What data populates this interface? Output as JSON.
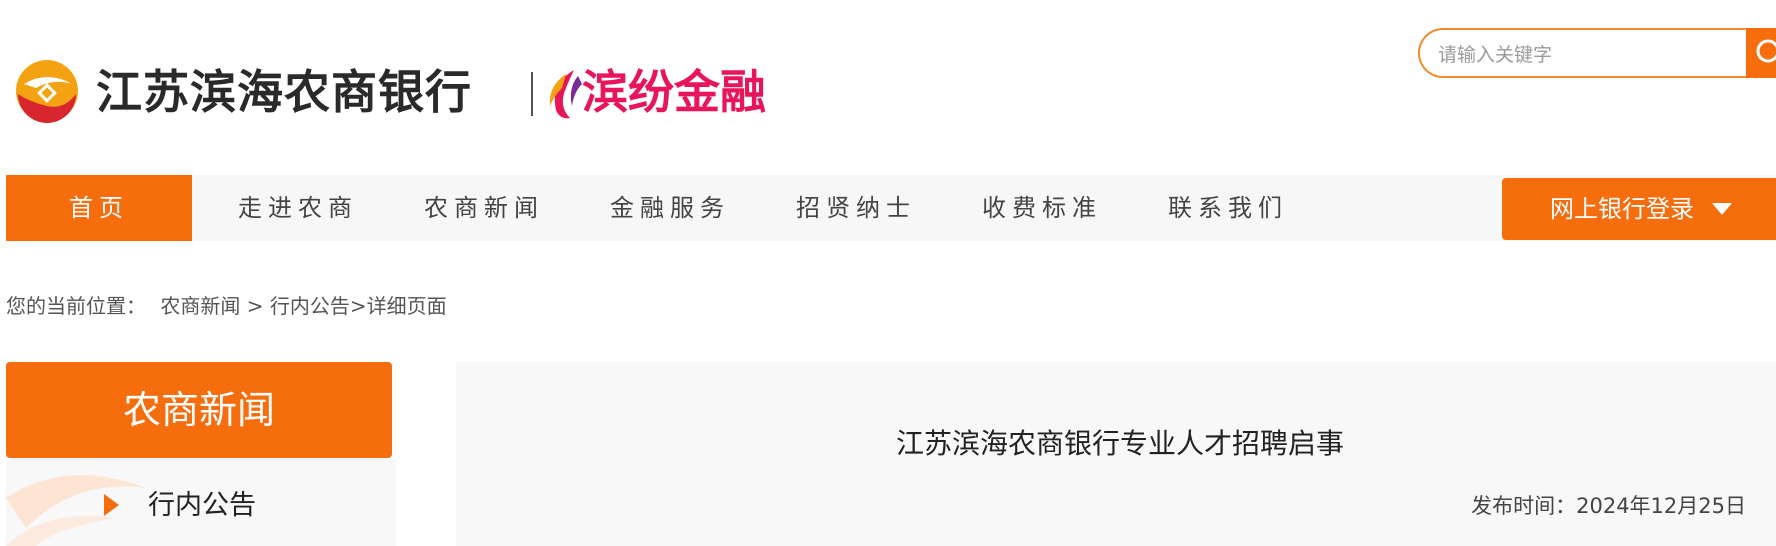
{
  "logo": {
    "bank_name": "江苏滨海农商银行",
    "slogan": "滨纷金融"
  },
  "search": {
    "placeholder": "请输入关键字"
  },
  "nav": {
    "items": [
      "首页",
      "走进农商",
      "农商新闻",
      "金融服务",
      "招贤纳士",
      "收费标准",
      "联系我们"
    ],
    "active_index": 0,
    "login_label": "网上银行登录"
  },
  "breadcrumb": {
    "label": "您的当前位置：",
    "path": "农商新闻 > 行内公告>详细页面"
  },
  "sidebar": {
    "title": "农商新闻",
    "items": [
      "行内公告"
    ]
  },
  "article": {
    "title": "江苏滨海农商银行专业人才招聘启事",
    "publish_time": "发布时间：2024年12月25日"
  },
  "colors": {
    "accent": "#f56d0d",
    "slogan": "#e8155a",
    "search_border": "#f68a2a"
  }
}
